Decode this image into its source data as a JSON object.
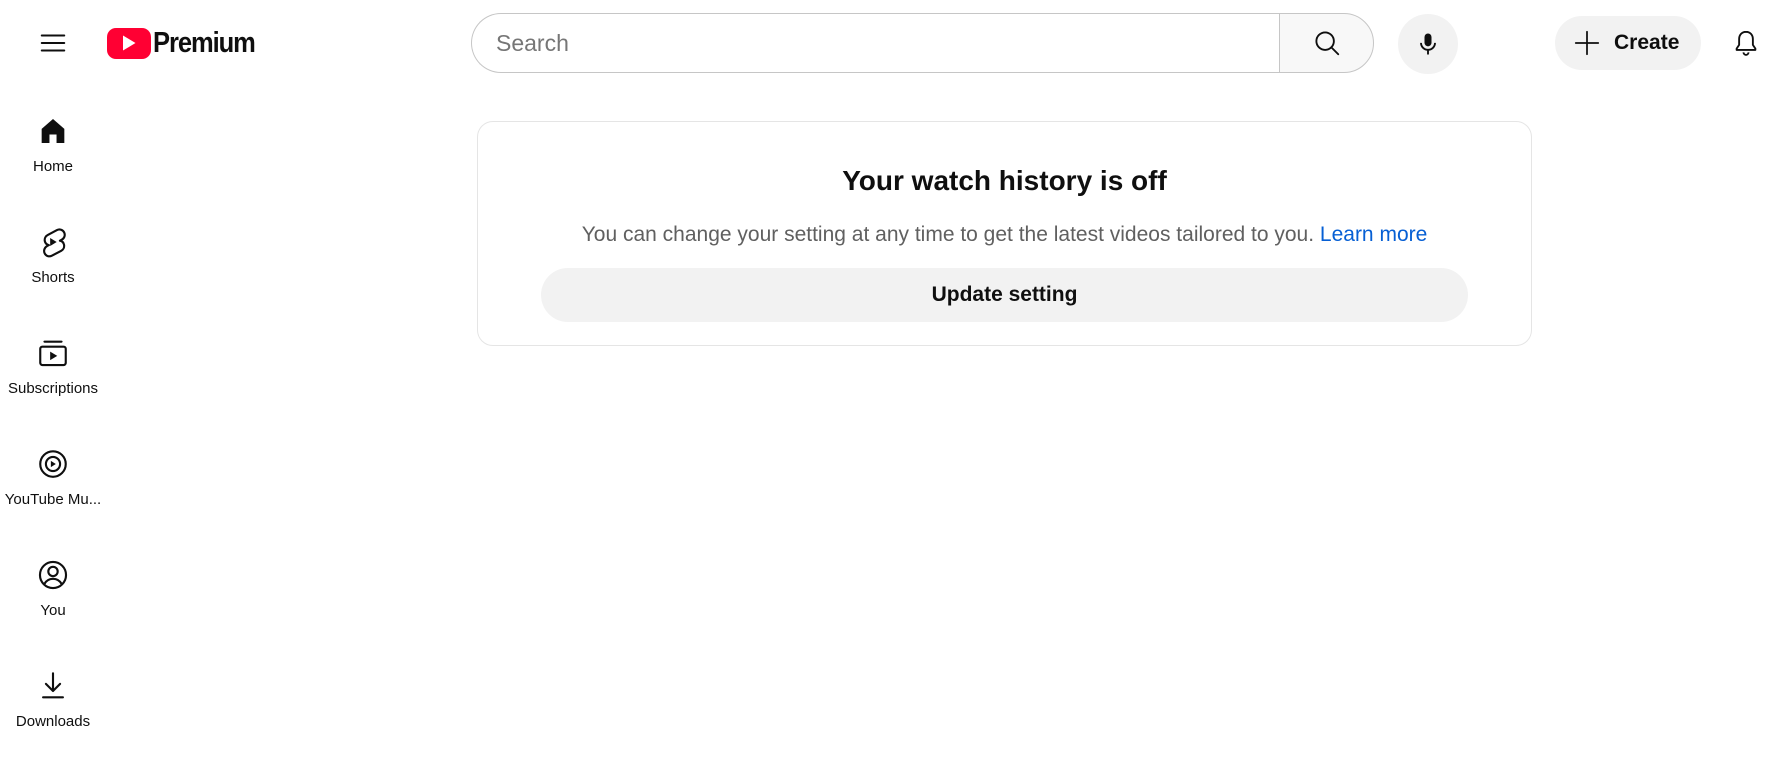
{
  "header": {
    "logo_text": "Premium",
    "search_placeholder": "Search",
    "search_value": "",
    "create_label": "Create"
  },
  "sidebar": {
    "items": [
      {
        "label": "Home",
        "icon": "home-icon"
      },
      {
        "label": "Shorts",
        "icon": "shorts-icon"
      },
      {
        "label": "Subscriptions",
        "icon": "subscriptions-icon"
      },
      {
        "label": "YouTube Mu...",
        "icon": "youtube-music-icon"
      },
      {
        "label": "You",
        "icon": "you-icon"
      },
      {
        "label": "Downloads",
        "icon": "downloads-icon"
      }
    ]
  },
  "history_card": {
    "title": "Your watch history is off",
    "description": "You can change your setting at any time to get the latest videos tailored to you.",
    "learn_more": "Learn more",
    "button_label": "Update setting"
  },
  "colors": {
    "brand_red": "#ff0033",
    "link_blue": "#065fd4",
    "chip_gray": "#f2f2f2",
    "text_primary": "#0f0f0f",
    "text_secondary": "#606060"
  }
}
